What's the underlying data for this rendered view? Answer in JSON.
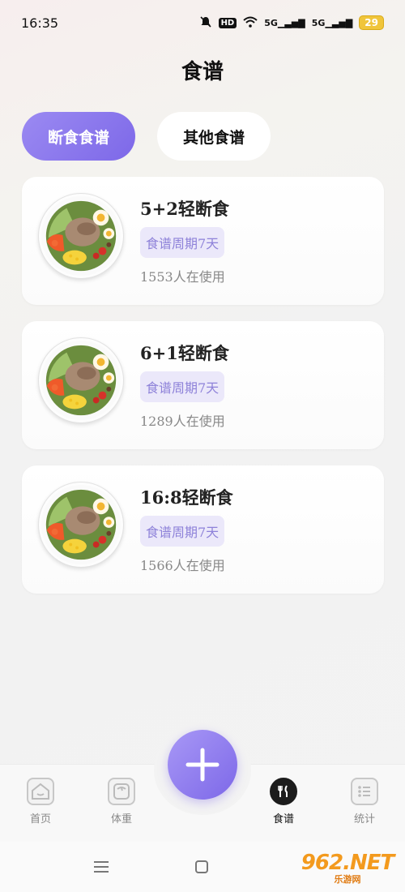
{
  "status_bar": {
    "time": "16:35",
    "network": "5G",
    "battery": "29"
  },
  "header": {
    "title": "食谱"
  },
  "tabs": [
    {
      "label": "断食食谱",
      "active": true
    },
    {
      "label": "其他食谱",
      "active": false
    }
  ],
  "recipes": [
    {
      "title": "5+2轻断食",
      "tag": "食谱周期7天",
      "users": "1553人在使用"
    },
    {
      "title": "6+1轻断食",
      "tag": "食谱周期7天",
      "users": "1289人在使用"
    },
    {
      "title": "16:8轻断食",
      "tag": "食谱周期7天",
      "users": "1566人在使用"
    }
  ],
  "bottom_nav": {
    "items": [
      {
        "label": "首页",
        "icon": "home-icon"
      },
      {
        "label": "体重",
        "icon": "scale-icon"
      },
      {
        "label": "食谱",
        "icon": "recipe-icon",
        "active": true
      },
      {
        "label": "统计",
        "icon": "stats-icon"
      }
    ],
    "fab_icon": "plus-icon"
  },
  "watermark": {
    "main": "962.NET",
    "sub": "乐游网"
  },
  "colors": {
    "accent": "#7d68e8",
    "tag_bg": "#ebe8fa",
    "tag_text": "#8e82d9"
  }
}
